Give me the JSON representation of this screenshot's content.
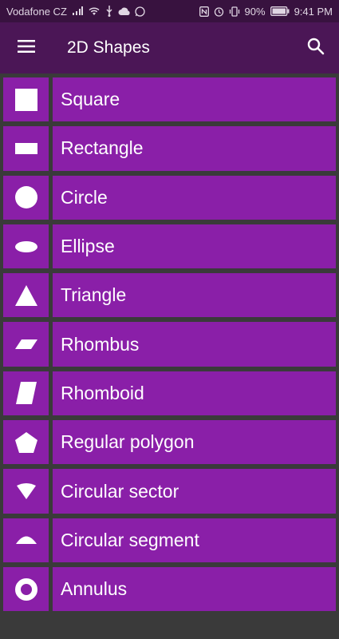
{
  "status_bar": {
    "carrier": "Vodafone CZ",
    "battery": "90%",
    "time": "9:41 PM"
  },
  "app_bar": {
    "title": "2D Shapes"
  },
  "shapes": [
    {
      "label": "Square",
      "icon": "square-icon"
    },
    {
      "label": "Rectangle",
      "icon": "rectangle-icon"
    },
    {
      "label": "Circle",
      "icon": "circle-icon"
    },
    {
      "label": "Ellipse",
      "icon": "ellipse-icon"
    },
    {
      "label": "Triangle",
      "icon": "triangle-icon"
    },
    {
      "label": "Rhombus",
      "icon": "rhombus-icon"
    },
    {
      "label": "Rhomboid",
      "icon": "rhomboid-icon"
    },
    {
      "label": "Regular polygon",
      "icon": "pentagon-icon"
    },
    {
      "label": "Circular sector",
      "icon": "circular-sector-icon"
    },
    {
      "label": "Circular segment",
      "icon": "circular-segment-icon"
    },
    {
      "label": "Annulus",
      "icon": "annulus-icon"
    }
  ],
  "colors": {
    "accent": "#8a1fa8",
    "app_bar": "#4b1656",
    "status_bar": "#38123f",
    "background": "#3a3a3a"
  }
}
